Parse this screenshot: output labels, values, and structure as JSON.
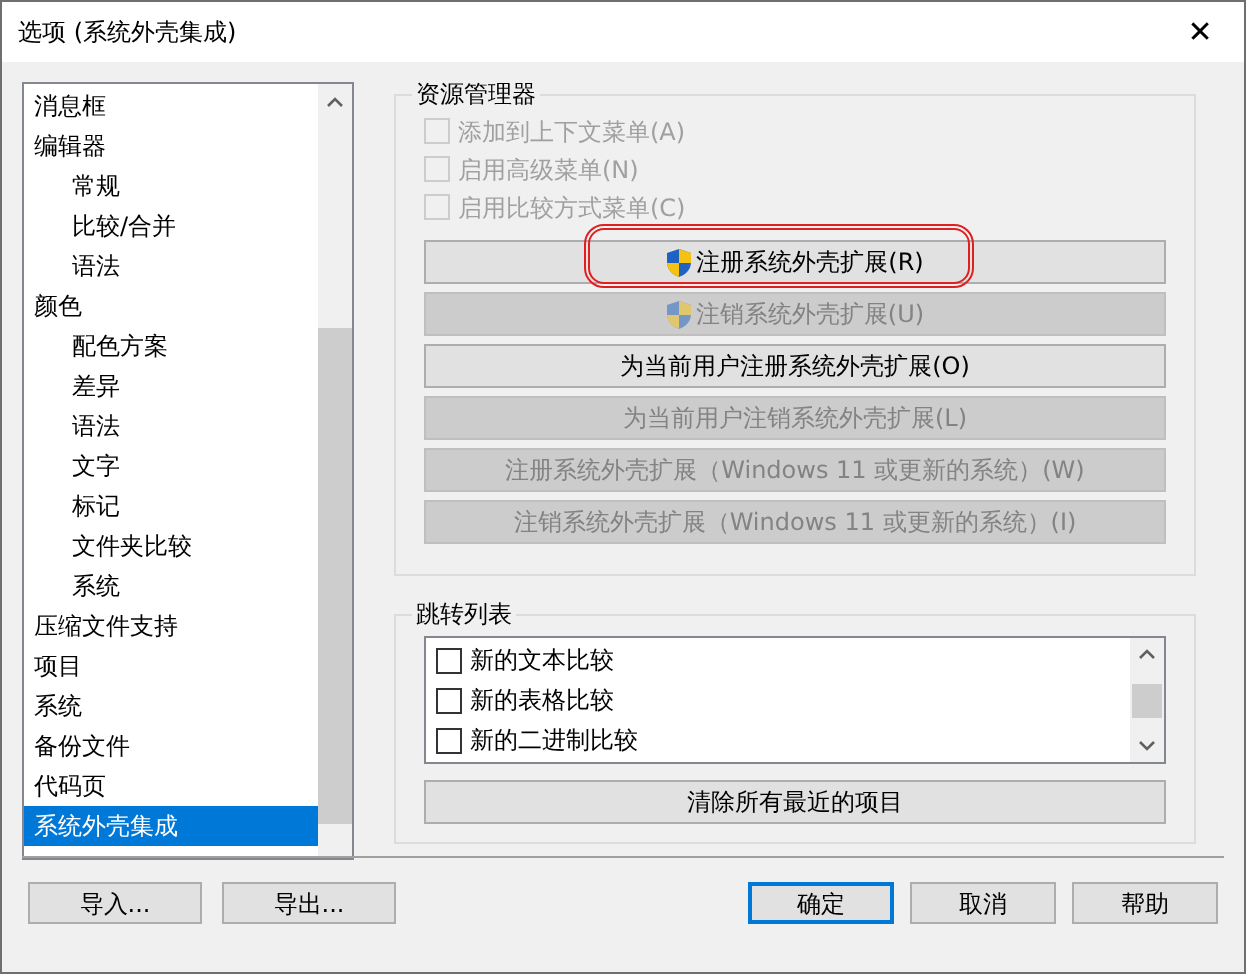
{
  "window": {
    "title": "选项 (系统外壳集成)",
    "close": "✕"
  },
  "tree": {
    "items": [
      {
        "label": "消息框",
        "selected": false
      },
      {
        "label": "编辑器",
        "selected": false,
        "children": [
          {
            "label": "常规",
            "selected": false
          },
          {
            "label": "比较/合并",
            "selected": false
          },
          {
            "label": "语法",
            "selected": false
          }
        ]
      },
      {
        "label": "颜色",
        "selected": false,
        "children": [
          {
            "label": "配色方案",
            "selected": false
          },
          {
            "label": "差异",
            "selected": false
          },
          {
            "label": "语法",
            "selected": false
          },
          {
            "label": "文字",
            "selected": false
          },
          {
            "label": "标记",
            "selected": false
          },
          {
            "label": "文件夹比较",
            "selected": false
          },
          {
            "label": "系统",
            "selected": false
          }
        ]
      },
      {
        "label": "压缩文件支持",
        "selected": false
      },
      {
        "label": "项目",
        "selected": false
      },
      {
        "label": "系统",
        "selected": false
      },
      {
        "label": "备份文件",
        "selected": false
      },
      {
        "label": "代码页",
        "selected": false
      },
      {
        "label": "系统外壳集成",
        "selected": true
      }
    ]
  },
  "explorer": {
    "title": "资源管理器",
    "checkboxes": [
      {
        "label": "添加到上下文菜单(A)",
        "checked": false,
        "disabled": true
      },
      {
        "label": "启用高级菜单(N)",
        "checked": false,
        "disabled": true
      },
      {
        "label": "启用比较方式菜单(C)",
        "checked": false,
        "disabled": true
      }
    ],
    "buttons": [
      {
        "label": "注册系统外壳扩展(R)",
        "shield": true,
        "disabled": false,
        "highlighted": true
      },
      {
        "label": "注销系统外壳扩展(U)",
        "shield": true,
        "disabled": true,
        "highlighted": false
      },
      {
        "label": "为当前用户注册系统外壳扩展(O)",
        "shield": false,
        "disabled": false,
        "highlighted": false
      },
      {
        "label": "为当前用户注销系统外壳扩展(L)",
        "shield": false,
        "disabled": true,
        "highlighted": false
      },
      {
        "label": "注册系统外壳扩展（Windows 11 或更新的系统）(W)",
        "shield": false,
        "disabled": true,
        "highlighted": false
      },
      {
        "label": "注销系统外壳扩展（Windows 11 或更新的系统）(I)",
        "shield": false,
        "disabled": true,
        "highlighted": false
      }
    ]
  },
  "jump_list": {
    "title": "跳转列表",
    "items": [
      {
        "label": "新的文本比较",
        "checked": false
      },
      {
        "label": "新的表格比较",
        "checked": false
      },
      {
        "label": "新的二进制比较",
        "checked": false
      }
    ],
    "clear_button": "清除所有最近的项目"
  },
  "footer": {
    "left_buttons": [
      "导入...",
      "导出..."
    ],
    "right_buttons": [
      {
        "label": "确定",
        "default": true
      },
      {
        "label": "取消",
        "default": false
      },
      {
        "label": "帮助",
        "default": false
      }
    ]
  }
}
